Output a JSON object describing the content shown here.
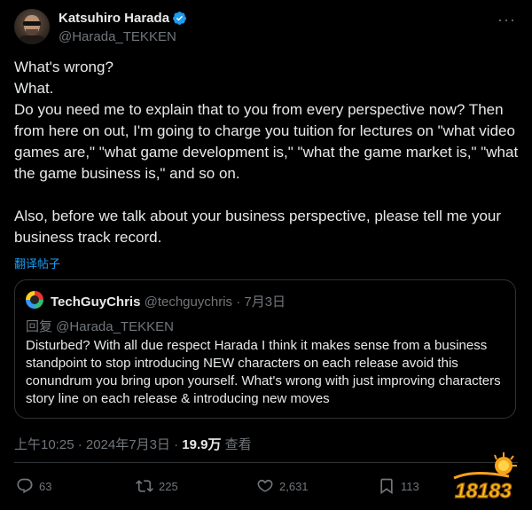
{
  "author": {
    "display_name": "Katsuhiro Harada",
    "handle": "@Harada_TEKKEN"
  },
  "tweet": {
    "text": "What's wrong?\nWhat.\nDo you need me to explain that to you from every perspective now? Then from here on out, I'm going to charge you tuition for lectures on \"what video games are,\" \"what game development is,\" \"what the game market is,\" \"what the game business is,\" and so on.\n\nAlso, before we talk about your business perspective, please tell me your business track record.",
    "translate_label": "翻译帖子"
  },
  "quote": {
    "display_name": "TechGuyChris",
    "meta": " @techguychris · 7月3日",
    "reply_to": "回复 @Harada_TEKKEN",
    "text": "Disturbed? With all due respect Harada I think it makes sense from a business standpoint to stop introducing NEW characters on each release avoid this conundrum you bring upon yourself. What's wrong with just improving characters story line on each release & introducing new moves"
  },
  "timestamp": {
    "time_date": "上午10:25 · 2024年7月3日 · ",
    "views": "19.9万",
    "views_label": " 查看"
  },
  "actions": {
    "replies": "63",
    "retweets": "225",
    "likes": "2,631",
    "bookmarks": "113"
  },
  "watermark": {
    "text": "18183"
  },
  "icons": {
    "verified": "verified-badge-icon",
    "more": "more-icon",
    "reply": "reply-icon",
    "retweet": "retweet-icon",
    "like": "heart-icon",
    "bookmark": "bookmark-icon"
  },
  "colors": {
    "background": "#000000",
    "text": "#e7e9ea",
    "muted": "#71767b",
    "accent": "#1d9bf0",
    "border": "#2f3336"
  }
}
